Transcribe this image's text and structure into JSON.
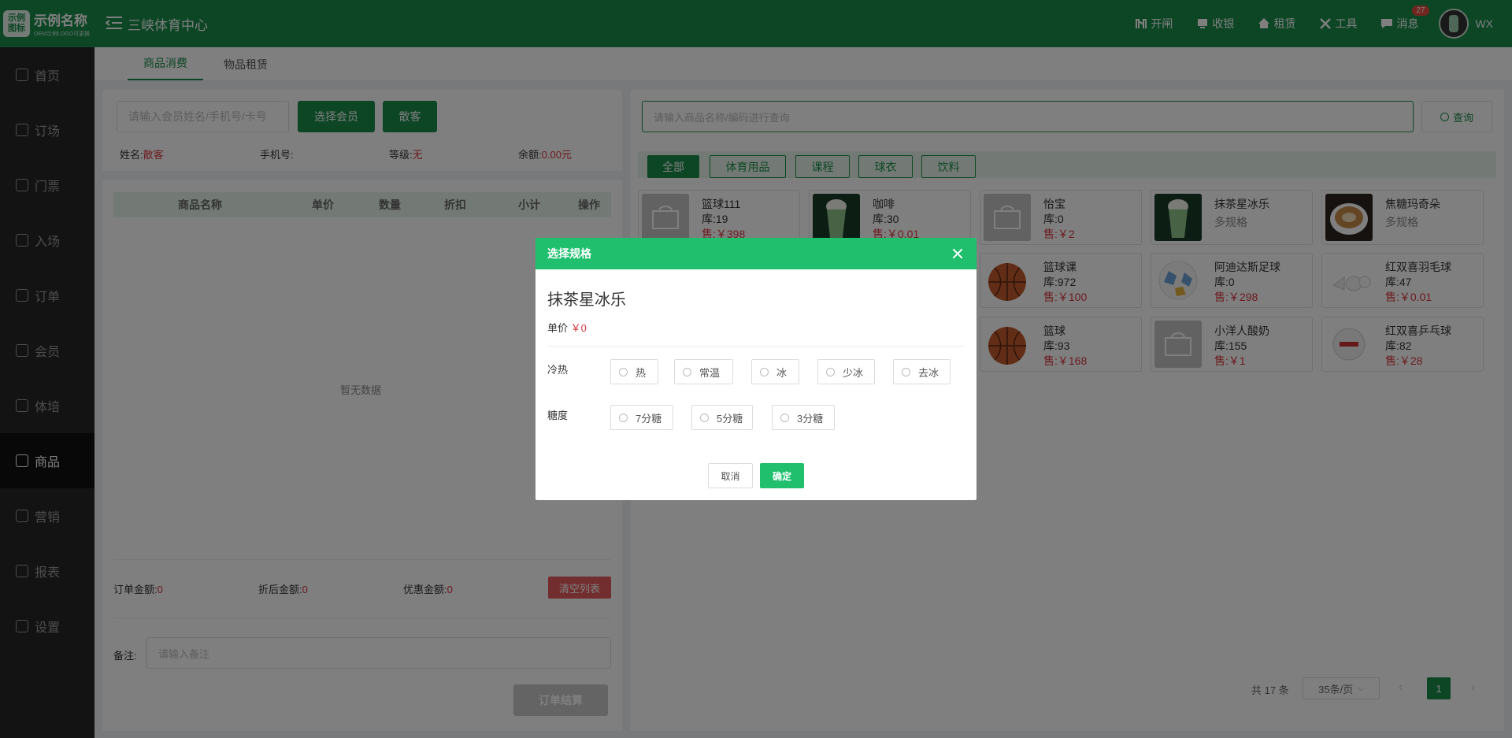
{
  "brand": {
    "logo_text": "示例\n图标",
    "name": "示例名称",
    "sub": "OEM示例LOGO可更换"
  },
  "header": {
    "venue": "三峡体育中心",
    "nav": [
      {
        "label": "开闸",
        "icon": "gate-icon"
      },
      {
        "label": "收银",
        "icon": "cashier-icon"
      },
      {
        "label": "租赁",
        "icon": "home-icon"
      },
      {
        "label": "工具",
        "icon": "tools-icon"
      },
      {
        "label": "消息",
        "icon": "message-icon"
      }
    ],
    "message_badge": "27",
    "user": "WX"
  },
  "sidebar": {
    "items": [
      {
        "label": "首页",
        "icon": "home-icon"
      },
      {
        "label": "订场",
        "icon": "booking-icon"
      },
      {
        "label": "门票",
        "icon": "ticket-icon"
      },
      {
        "label": "入场",
        "icon": "enter-icon"
      },
      {
        "label": "订单",
        "icon": "order-icon"
      },
      {
        "label": "会员",
        "icon": "member-icon"
      },
      {
        "label": "体培",
        "icon": "training-icon"
      },
      {
        "label": "商品",
        "icon": "goods-icon"
      },
      {
        "label": "营销",
        "icon": "marketing-icon"
      },
      {
        "label": "报表",
        "icon": "report-icon"
      },
      {
        "label": "设置",
        "icon": "settings-icon"
      }
    ],
    "active_index": 7
  },
  "tabs": [
    {
      "label": "商品消费"
    },
    {
      "label": "物品租赁"
    }
  ],
  "member": {
    "search_placeholder": "请输入会员姓名/手机号/卡号",
    "select_label": "选择会员",
    "guest_label": "散客",
    "name_label": "姓名:",
    "name_value": "散客",
    "phone_label": "手机号:",
    "phone_value": "",
    "level_label": "等级:",
    "level_value": "无",
    "balance_label": "余额:",
    "balance_value": "0.00元"
  },
  "cart": {
    "columns": [
      "商品名称",
      "单价",
      "数量",
      "折扣",
      "小计",
      "操作"
    ],
    "empty_text": "暂无数据",
    "order_amount_label": "订单金额:",
    "order_amount": "0",
    "discounted_label": "折后金额:",
    "discounted": "0",
    "coupon_label": "优惠金额:",
    "coupon": "0",
    "clear_label": "清空列表",
    "remark_label": "备注:",
    "remark_placeholder": "请输入备注",
    "checkout_label": "订单结算"
  },
  "products": {
    "search_placeholder": "请输入商品名称/编码进行查询",
    "query_label": "查询",
    "categories": [
      "全部",
      "体育用品",
      "课程",
      "球衣",
      "饮料"
    ],
    "items": [
      {
        "name": "篮球111",
        "stock": "库:19",
        "price": "售:￥398",
        "thumb": "gray"
      },
      {
        "name": "咖啡",
        "stock": "库:30",
        "price": "售:￥0.01",
        "thumb": "matcha"
      },
      {
        "name": "怡宝",
        "stock": "库:0",
        "price": "售:￥2",
        "thumb": "gray"
      },
      {
        "name": "抹茶星冰乐",
        "stock": "",
        "price": "",
        "multi": "多规格",
        "thumb": "matcha"
      },
      {
        "name": "焦糖玛奇朵",
        "stock": "",
        "price": "",
        "multi": "多规格",
        "thumb": "coffee"
      },
      {
        "name": "",
        "stock": "",
        "price": "",
        "thumb": "hidden"
      },
      {
        "name": "",
        "stock": "",
        "price": "",
        "thumb": "hidden"
      },
      {
        "name": "篮球课",
        "stock": "库:972",
        "price": "售:￥100",
        "thumb": "ball"
      },
      {
        "name": "阿迪达斯足球",
        "stock": "库:0",
        "price": "售:￥298",
        "thumb": "football"
      },
      {
        "name": "红双喜羽毛球",
        "stock": "库:47",
        "price": "售:￥0.01",
        "thumb": "shuttle"
      },
      {
        "name": "",
        "stock": "",
        "price": "",
        "thumb": "hidden"
      },
      {
        "name": "",
        "stock": "",
        "price": "",
        "thumb": "hidden"
      },
      {
        "name": "篮球",
        "stock": "库:93",
        "price": "售:￥168",
        "thumb": "ball"
      },
      {
        "name": "小洋人酸奶",
        "stock": "库:155",
        "price": "售:￥1",
        "thumb": "gray"
      },
      {
        "name": "红双喜乒乓球",
        "stock": "库:82",
        "price": "售:￥28",
        "thumb": "pingpong"
      }
    ],
    "total_text": "共 17 条",
    "page_size": "35条/页",
    "current_page": "1"
  },
  "dialog": {
    "title": "选择规格",
    "product_name": "抹茶星冰乐",
    "price_label": "单价",
    "price_value": "￥0",
    "temp_label": "冷热",
    "temp_options": [
      "热",
      "常温",
      "冰",
      "少冰",
      "去冰"
    ],
    "sugar_label": "糖度",
    "sugar_options": [
      "7分糖",
      "5分糖",
      "3分糖"
    ],
    "cancel_label": "取消",
    "confirm_label": "确定"
  }
}
